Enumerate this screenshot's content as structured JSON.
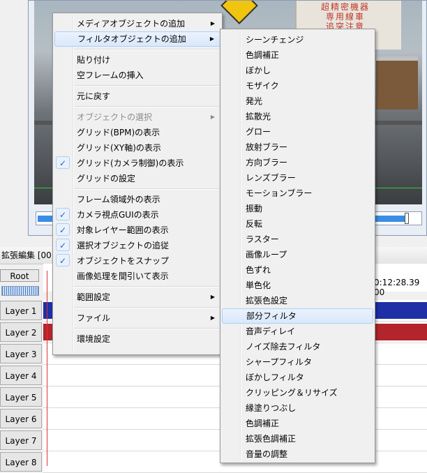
{
  "preview": {
    "wall_text_line1": "超精密機器",
    "wall_text_line2": "専用線車",
    "wall_text_line3": "追突注意",
    "seek_progress_fraction": 0.97
  },
  "timeline": {
    "title": "拡張編集 [00:",
    "root_label": "Root",
    "time_label": "0:12:28.39  00",
    "layers": [
      {
        "label": "Layer 1",
        "object_color": "#1f2fa6"
      },
      {
        "label": "Layer 2",
        "object_color": "#b3252c"
      },
      {
        "label": "Layer 3",
        "object_color": ""
      },
      {
        "label": "Layer 4",
        "object_color": ""
      },
      {
        "label": "Layer 5",
        "object_color": ""
      },
      {
        "label": "Layer 6",
        "object_color": ""
      },
      {
        "label": "Layer 7",
        "object_color": ""
      },
      {
        "label": "Layer 8",
        "object_color": ""
      }
    ]
  },
  "context_menu": {
    "items": [
      {
        "label": "メディアオブジェクトの追加",
        "submenu": true
      },
      {
        "label": "フィルタオブジェクトの追加",
        "submenu": true,
        "highlighted": true
      },
      {
        "label": "貼り付け"
      },
      {
        "label": "空フレームの挿入"
      },
      {
        "label": "元に戻す"
      },
      {
        "label": "オブジェクトの選択",
        "submenu": true,
        "disabled": true
      },
      {
        "label": "グリッド(BPM)の表示"
      },
      {
        "label": "グリッド(XY軸)の表示"
      },
      {
        "label": "グリッド(カメラ制御)の表示",
        "checked": true
      },
      {
        "label": "グリッドの設定"
      },
      {
        "label": "フレーム領域外の表示"
      },
      {
        "label": "カメラ視点GUIの表示",
        "checked": true
      },
      {
        "label": "対象レイヤー範囲の表示",
        "checked": true
      },
      {
        "label": "選択オブジェクトの追従",
        "checked": true
      },
      {
        "label": "オブジェクトをスナップ",
        "checked": true
      },
      {
        "label": "画像処理を間引いて表示"
      },
      {
        "label": "範囲設定",
        "submenu": true
      },
      {
        "label": "ファイル",
        "submenu": true
      },
      {
        "label": "環境設定"
      }
    ],
    "check_glyph": "✓",
    "arrow_glyph": "▶"
  },
  "filter_submenu": {
    "items": [
      {
        "label": "シーンチェンジ"
      },
      {
        "label": "色調補正"
      },
      {
        "label": "ぼかし"
      },
      {
        "label": "モザイク"
      },
      {
        "label": "発光"
      },
      {
        "label": "拡散光"
      },
      {
        "label": "グロー"
      },
      {
        "label": "放射ブラー"
      },
      {
        "label": "方向ブラー"
      },
      {
        "label": "レンズブラー"
      },
      {
        "label": "モーションブラー"
      },
      {
        "label": "振動"
      },
      {
        "label": "反転"
      },
      {
        "label": "ラスター"
      },
      {
        "label": "画像ループ"
      },
      {
        "label": "色ずれ"
      },
      {
        "label": "単色化"
      },
      {
        "label": "拡張色設定"
      },
      {
        "label": "部分フィルタ",
        "highlighted": true
      },
      {
        "label": "音声ディレイ"
      },
      {
        "label": "ノイズ除去フィルタ"
      },
      {
        "label": "シャープフィルタ"
      },
      {
        "label": "ぼかしフィルタ"
      },
      {
        "label": "クリッピング＆リサイズ"
      },
      {
        "label": "縁塗りつぶし"
      },
      {
        "label": "色調補正"
      },
      {
        "label": "拡張色調補正"
      },
      {
        "label": "音量の調整"
      }
    ]
  }
}
